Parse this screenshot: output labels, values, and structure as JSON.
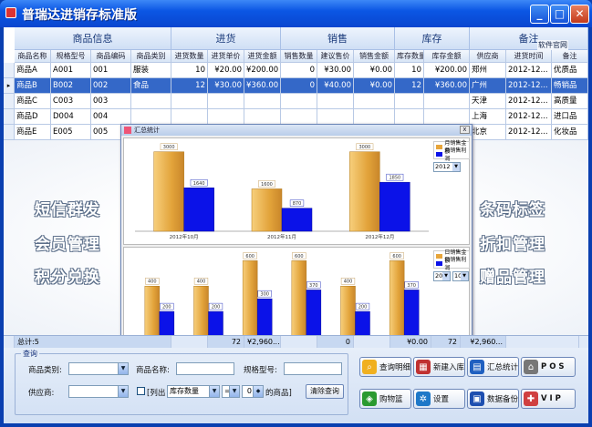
{
  "window": {
    "title": "普瑞达进销存标准版",
    "min": "_",
    "max": "□",
    "close": "✕"
  },
  "grid": {
    "groups": [
      "商品信息",
      "进货",
      "销售",
      "库存",
      "备注"
    ],
    "official_site": "软件官网",
    "columns": [
      "商品名称",
      "规格型号",
      "商品编码",
      "商品类别",
      "进货数量",
      "进货单价",
      "进货金额",
      "销售数量",
      "建议售价",
      "销售金额",
      "库存数量",
      "库存金额",
      "供应商",
      "进货时间",
      "备注"
    ],
    "rows": [
      [
        "商品A",
        "A001",
        "001",
        "服装",
        "10",
        "¥20.00",
        "¥200.00",
        "0",
        "¥30.00",
        "¥0.00",
        "10",
        "¥200.00",
        "郑州",
        "2012-12...",
        "优质品"
      ],
      [
        "商品B",
        "B002",
        "002",
        "食品",
        "12",
        "¥30.00",
        "¥360.00",
        "0",
        "¥40.00",
        "¥0.00",
        "12",
        "¥360.00",
        "广州",
        "2012-12...",
        "畅销品"
      ],
      [
        "商品C",
        "C003",
        "003",
        "",
        "",
        "",
        "",
        "",
        "",
        "",
        "",
        "",
        "天津",
        "2012-12...",
        "高质量"
      ],
      [
        "商品D",
        "D004",
        "004",
        "",
        "",
        "",
        "",
        "",
        "",
        "",
        "",
        "",
        "上海",
        "2012-12...",
        "进口品"
      ],
      [
        "商品E",
        "E005",
        "005",
        "",
        "",
        "",
        "",
        "",
        "",
        "",
        "",
        "",
        "北京",
        "2012-12...",
        "化妆品"
      ]
    ],
    "selected_row": 1
  },
  "promo": {
    "left": [
      "短信群发",
      "会员管理",
      "积分兑换"
    ],
    "right": [
      "条码标签",
      "折扣管理",
      "赠品管理"
    ]
  },
  "popup": {
    "title": "汇总统计",
    "close": "x",
    "legend": [
      "月销售金额",
      "月销售利润"
    ],
    "legend2": [
      "日销售金额",
      "日销售利润"
    ],
    "year": "2012",
    "month": "10",
    "colors": {
      "amount": "#e7a53b",
      "profit": "#0b12e8"
    }
  },
  "chart_data": [
    {
      "type": "bar",
      "categories": [
        "2012年10月",
        "2012年11月",
        "2012年12月"
      ],
      "series": [
        {
          "name": "月销售金额",
          "values": [
            3000,
            1600,
            3000
          ]
        },
        {
          "name": "月销售利润",
          "values": [
            1640,
            870,
            1850
          ]
        }
      ],
      "ylim": [
        0,
        3300
      ]
    },
    {
      "type": "bar",
      "categories": [
        "06",
        "07",
        "08",
        "09",
        "10",
        "11"
      ],
      "series": [
        {
          "name": "日销售金额",
          "values": [
            400,
            400,
            600,
            600,
            400,
            600
          ]
        },
        {
          "name": "日销售利润",
          "values": [
            200,
            200,
            300,
            370,
            200,
            370
          ]
        }
      ],
      "ylim": [
        0,
        660
      ]
    }
  ],
  "totals": {
    "label": "总计:5",
    "qty_in": "72",
    "amount_in": "¥2,960...",
    "qty_sold": "0",
    "amount_sold": "¥0.00",
    "qty_stock": "72",
    "amount_stock": "¥2,960..."
  },
  "query": {
    "legend": "查询",
    "category_label": "商品类别:",
    "name_label": "商品名称:",
    "spec_label": "规格型号:",
    "supplier_label": "供应商:",
    "list_label": "[列出",
    "list_field": "库存数量",
    "op": "=",
    "value": "0",
    "unit": "的商品]",
    "clear_button": "清除查询"
  },
  "toolbar": {
    "detail": "查询明细",
    "new_stock": "新建入库",
    "summary": "汇总统计",
    "pos": "P O S",
    "shopping": "购物篮",
    "settings": "设置",
    "backup": "数据备份",
    "vip": "V I P"
  }
}
